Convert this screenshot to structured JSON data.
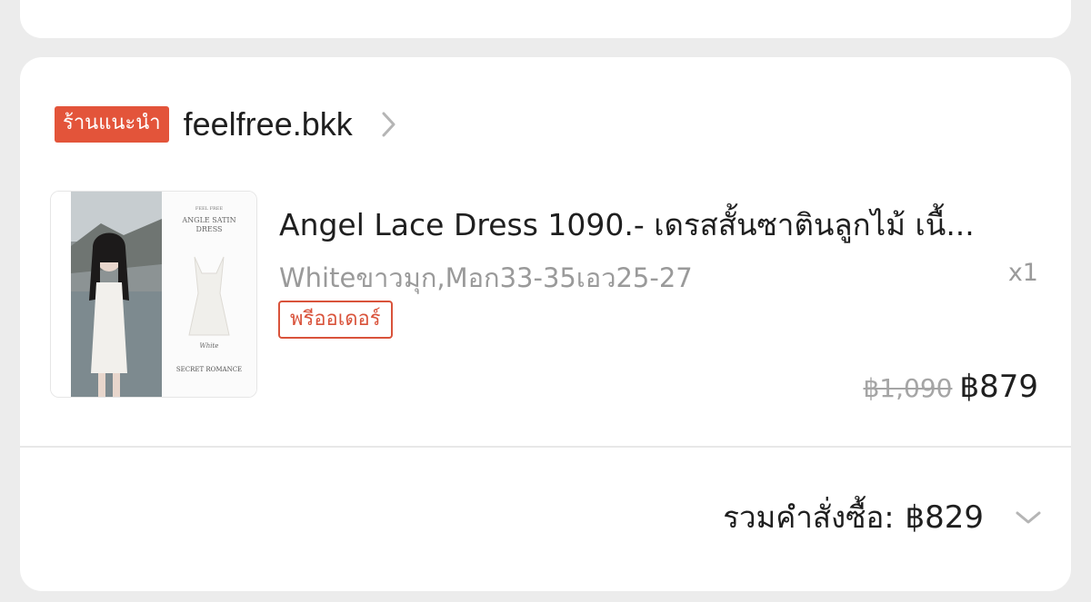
{
  "order": {
    "shop_badge": "ร้านแนะนำ",
    "shop_name": "feelfree.bkk",
    "item": {
      "title": "Angel Lace Dress 1090.- เดรสสั้นซาตินลูกไม้ เนื้...",
      "variant": "Whiteขาวมุก,Mอก33-35เอว25-27",
      "quantity": "x1",
      "preorder_tag": "พรีออเดอร์",
      "original_price": "฿1,090",
      "price": "฿879",
      "image": {
        "poster_brand": "FEEL FREE",
        "poster_title_1": "ANGLE SATIN",
        "poster_title_2": "DRESS",
        "poster_color": "White",
        "poster_collection": "SECRET ROMANCE"
      }
    },
    "total_label": "รวมคำสั่งซื้อ:",
    "total_value": "฿829"
  },
  "colors": {
    "badge": "#e3543a",
    "preorder": "#d9533b",
    "page_bg": "#ececec",
    "card_bg": "#ffffff"
  },
  "icons": {
    "shop_chevron": "chevron-right-icon",
    "total_chevron": "chevron-down-icon"
  }
}
